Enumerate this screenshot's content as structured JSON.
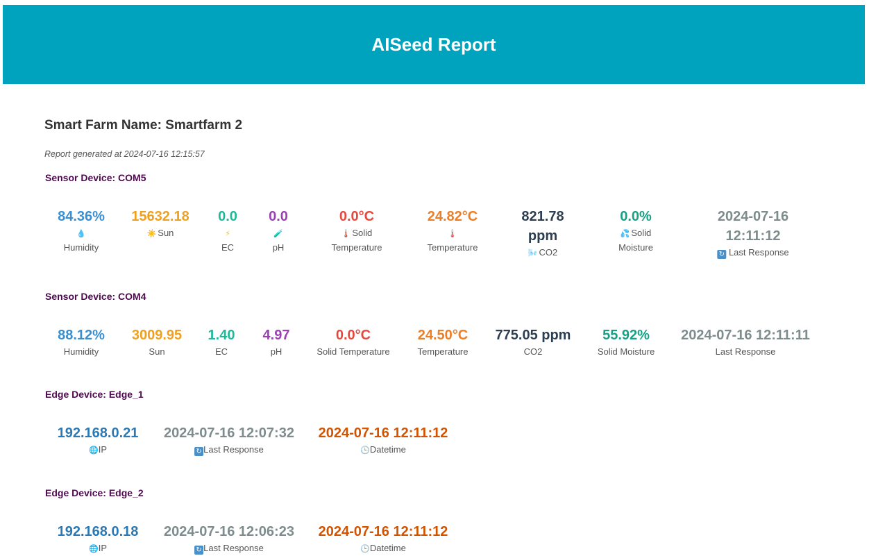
{
  "header": {
    "title": "AISeed Report"
  },
  "farm": {
    "name_line": "Smart Farm Name: Smartfarm 2",
    "report_line": "Report generated at 2024-07-16 12:15:57"
  },
  "sensor1": {
    "title": "Sensor Device: COM5",
    "humidity": {
      "value": "84.36%",
      "label": "Humidity",
      "icon": "droplet-icon"
    },
    "sun": {
      "value": "15632.18",
      "label": "Sun",
      "icon": "sun-icon"
    },
    "ec": {
      "value": "0.0",
      "label": "EC",
      "icon": "lightning-icon"
    },
    "ph": {
      "value": "0.0",
      "label": "pH",
      "icon": "test-tube-icon"
    },
    "solid_temp": {
      "value": "0.0°C",
      "label_a": "Solid",
      "label_b": "Temperature",
      "icon": "thermometer-icon"
    },
    "temp": {
      "value": "24.82°C",
      "label": "Temperature",
      "icon": "thermometer-icon"
    },
    "co2": {
      "value_a": "821.78",
      "value_b": "ppm",
      "label": "CO2",
      "icon": "wind-icon"
    },
    "solid_moist": {
      "value": "0.0%",
      "label_a": "Solid",
      "label_b": "Moisture",
      "icon": "sweat-drops-icon"
    },
    "last_response": {
      "value_a": "2024-07-16",
      "value_b": "12:11:12",
      "label": "Last Response",
      "icon": "refresh-icon"
    }
  },
  "sensor2": {
    "title": "Sensor Device: COM4",
    "humidity": {
      "value": "88.12%",
      "label": "Humidity"
    },
    "sun": {
      "value": "3009.95",
      "label": "Sun"
    },
    "ec": {
      "value": "1.40",
      "label": "EC"
    },
    "ph": {
      "value": "4.97",
      "label": "pH"
    },
    "solid_temp": {
      "value": "0.0°C",
      "label": "Solid Temperature"
    },
    "temp": {
      "value": "24.50°C",
      "label": "Temperature"
    },
    "co2": {
      "value": "775.05 ppm",
      "label": "CO2"
    },
    "solid_moist": {
      "value": "55.92%",
      "label": "Solid Moisture"
    },
    "last_response": {
      "value": "2024-07-16 12:11:11",
      "label": "Last Response"
    }
  },
  "edge1": {
    "title": "Edge Device: Edge_1",
    "ip": {
      "value": "192.168.0.21",
      "label": "IP",
      "icon": "globe-icon"
    },
    "last_response": {
      "value": "2024-07-16 12:07:32",
      "label": "Last Response",
      "icon": "refresh-icon"
    },
    "datetime": {
      "value": "2024-07-16 12:11:12",
      "label": "Datetime",
      "icon": "clock-icon"
    }
  },
  "edge2": {
    "title": "Edge Device: Edge_2",
    "ip": {
      "value": "192.168.0.18",
      "label": "IP",
      "icon": "globe-icon"
    },
    "last_response": {
      "value": "2024-07-16 12:06:23",
      "label": "Last Response",
      "icon": "refresh-icon"
    },
    "datetime": {
      "value": "2024-07-16 12:11:12",
      "label": "Datetime",
      "icon": "clock-icon"
    }
  }
}
